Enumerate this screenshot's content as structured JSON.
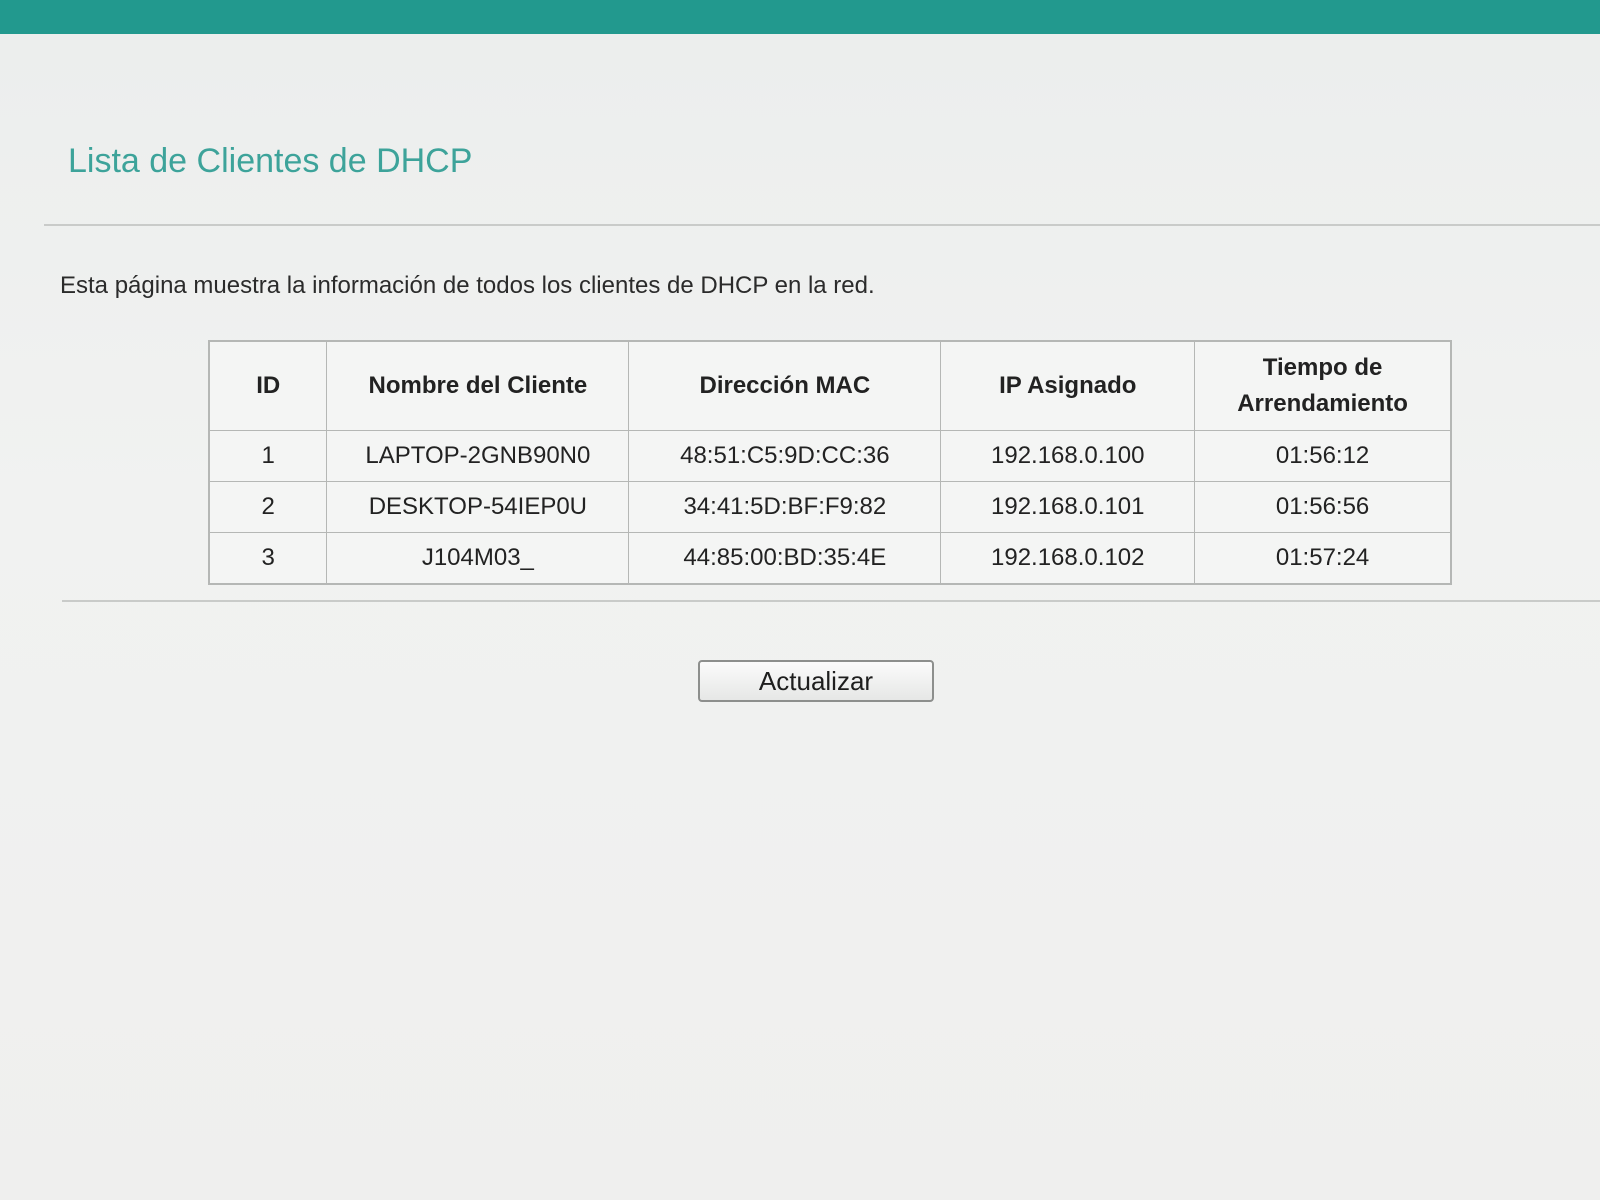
{
  "page": {
    "title": "Lista de Clientes de DHCP",
    "description": "Esta página muestra la información de todos los clientes de DHCP en la red."
  },
  "table": {
    "headers": {
      "id": "ID",
      "client_name": "Nombre del Cliente",
      "mac": "Dirección MAC",
      "ip": "IP Asignado",
      "lease_line1": "Tiempo de",
      "lease_line2": "Arrendamiento"
    },
    "rows": [
      {
        "id": "1",
        "client_name": "LAPTOP-2GNB90N0",
        "mac": "48:51:C5:9D:CC:36",
        "ip": "192.168.0.100",
        "lease": "01:56:12"
      },
      {
        "id": "2",
        "client_name": "DESKTOP-54IEP0U",
        "mac": "34:41:5D:BF:F9:82",
        "ip": "192.168.0.101",
        "lease": "01:56:56"
      },
      {
        "id": "3",
        "client_name": "J104M03_",
        "mac": "44:85:00:BD:35:4E",
        "ip": "192.168.0.102",
        "lease": "01:57:24"
      }
    ]
  },
  "actions": {
    "refresh_label": "Actualizar"
  },
  "colors": {
    "accent": "#3da39a",
    "frame": "#22998e"
  }
}
